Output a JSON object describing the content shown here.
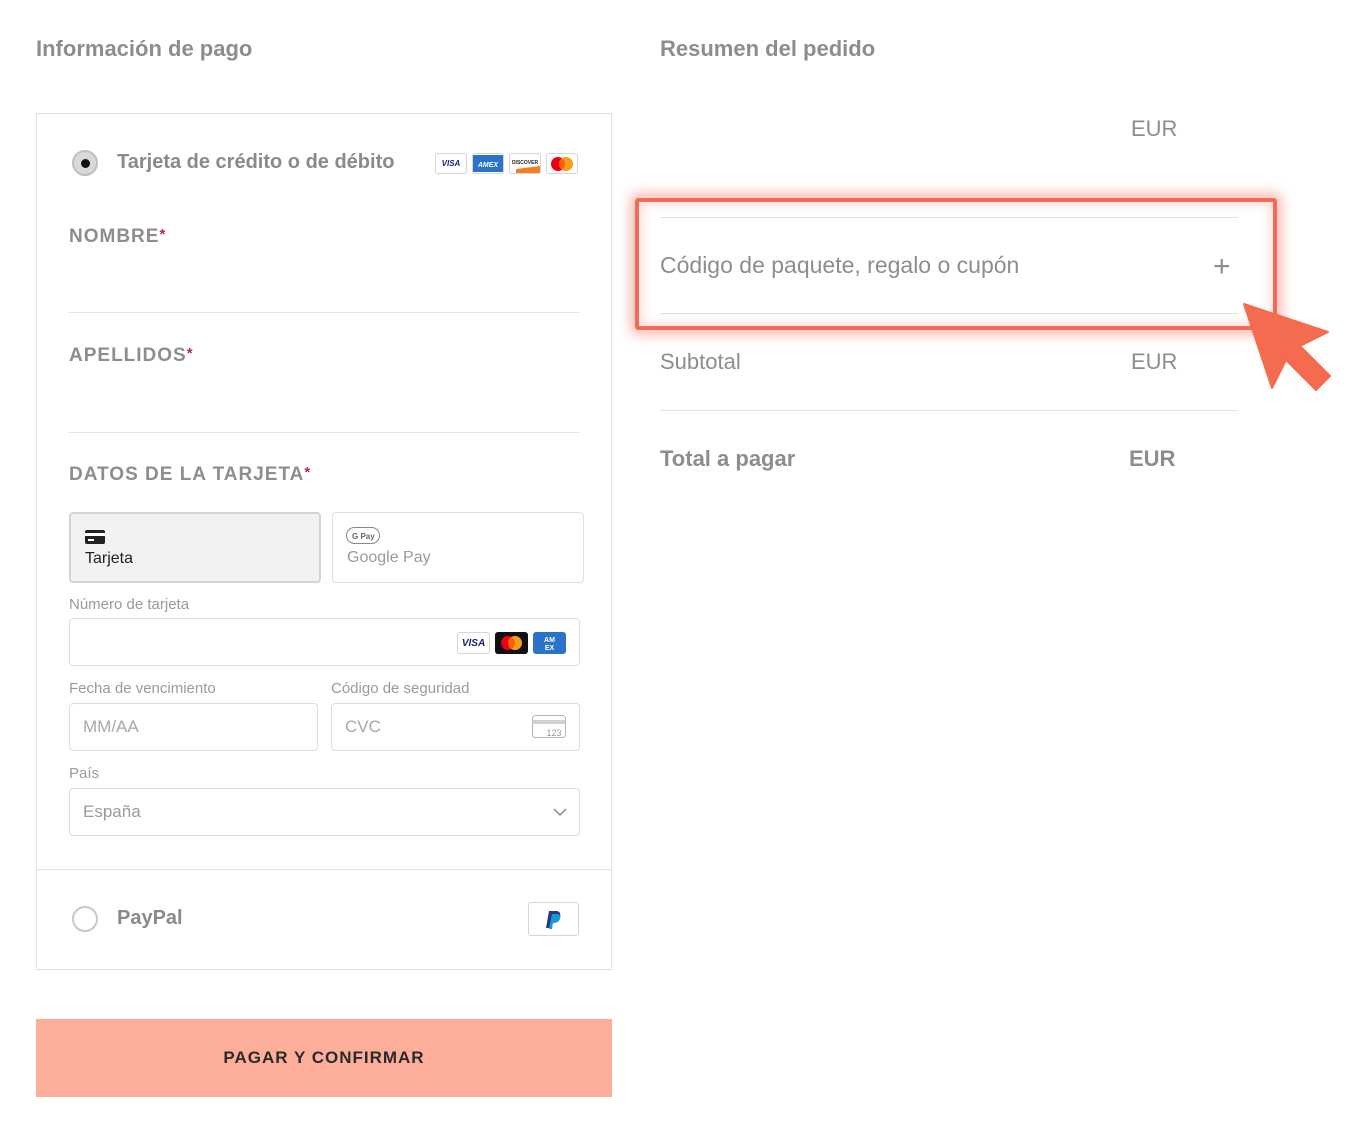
{
  "payment": {
    "title": "Información de pago",
    "card_option": {
      "label": "Tarjeta de crédito o de débito",
      "selected": true,
      "brand_icons": [
        "visa-icon",
        "amex-icon",
        "discover-icon",
        "mastercard-icon"
      ]
    },
    "fields": {
      "nombre_label": "NOMBRE",
      "apellidos_label": "APELLIDOS",
      "card_data_label": "DATOS DE LA TARJETA",
      "required_mark": "*"
    },
    "tabs": [
      {
        "label": "Tarjeta",
        "icon": "credit-card-icon",
        "active": true
      },
      {
        "label": "Google Pay",
        "icon": "google-pay-icon",
        "active": false
      }
    ],
    "card_number": {
      "label": "Número de tarjeta",
      "value": ""
    },
    "expiry": {
      "label": "Fecha de vencimiento",
      "placeholder": "MM/AA"
    },
    "security": {
      "label": "Código de seguridad",
      "placeholder": "CVC"
    },
    "country": {
      "label": "País",
      "value": "España"
    },
    "paypal_option": {
      "label": "PayPal",
      "selected": false
    },
    "submit_label": "PAGAR Y CONFIRMAR",
    "submit_color": "#fdae9b"
  },
  "summary": {
    "title": "Resumen del pedido",
    "top_currency": "EUR",
    "coupon_label": "Código de paquete, regalo o cupón",
    "coupon_icon": "plus-icon",
    "subtotal_label": "Subtotal",
    "subtotal_currency": "EUR",
    "total_label": "Total a pagar",
    "total_currency": "EUR"
  },
  "annotation": {
    "highlight_color": "#f56b5a",
    "cursor_icon": "arrow-cursor-icon"
  }
}
